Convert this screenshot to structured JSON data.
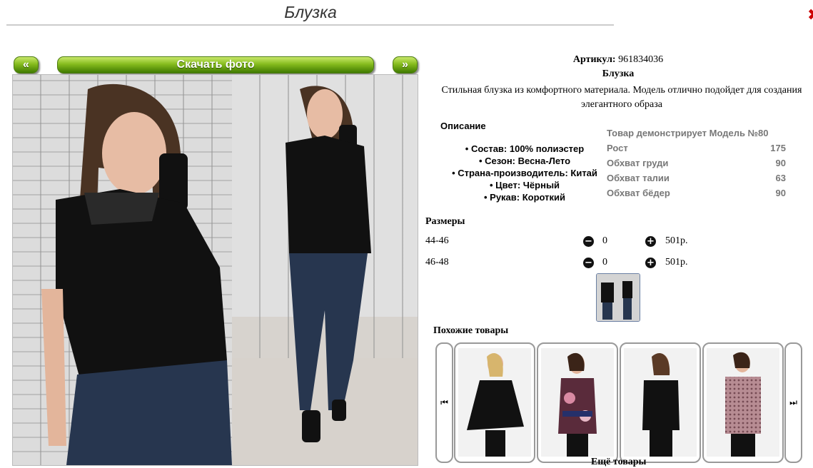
{
  "page": {
    "title": "Блузка",
    "close_symbol": "✖"
  },
  "gallery": {
    "prev_label": "«",
    "download_label": "Скачать фото",
    "next_label": "»"
  },
  "product": {
    "article_label": "Артикул:",
    "article_value": "961834036",
    "name": "Блузка",
    "description": "Стильная блузка из комфортного материала. Модель отлично подойдет для создания элегантного образа"
  },
  "details": {
    "heading": "Описание",
    "items": [
      "• Состав: 100% полиэстер",
      "• Сезон: Весна-Лето",
      "• Страна-производитель: Китай",
      "• Цвет: Чёрный",
      "• Рукав: Короткий"
    ]
  },
  "model": {
    "heading": "Товар демонстрирует Модель №80",
    "rows": [
      {
        "label": "Рост",
        "value": "175"
      },
      {
        "label": "Обхват груди",
        "value": "90"
      },
      {
        "label": "Обхват талии",
        "value": "63"
      },
      {
        "label": "Обхват бёдер",
        "value": "90"
      }
    ]
  },
  "sizes": {
    "heading": "Размеры",
    "rows": [
      {
        "size": "44-46",
        "qty": "0",
        "price": "501р."
      },
      {
        "size": "46-48",
        "qty": "0",
        "price": "501р."
      }
    ]
  },
  "similar": {
    "heading": "Похожие товары",
    "more_label": "Ещё товары"
  },
  "colors": {
    "button_green": "#86bc1e",
    "close_red": "#cc0000",
    "model_text": "#777777"
  }
}
